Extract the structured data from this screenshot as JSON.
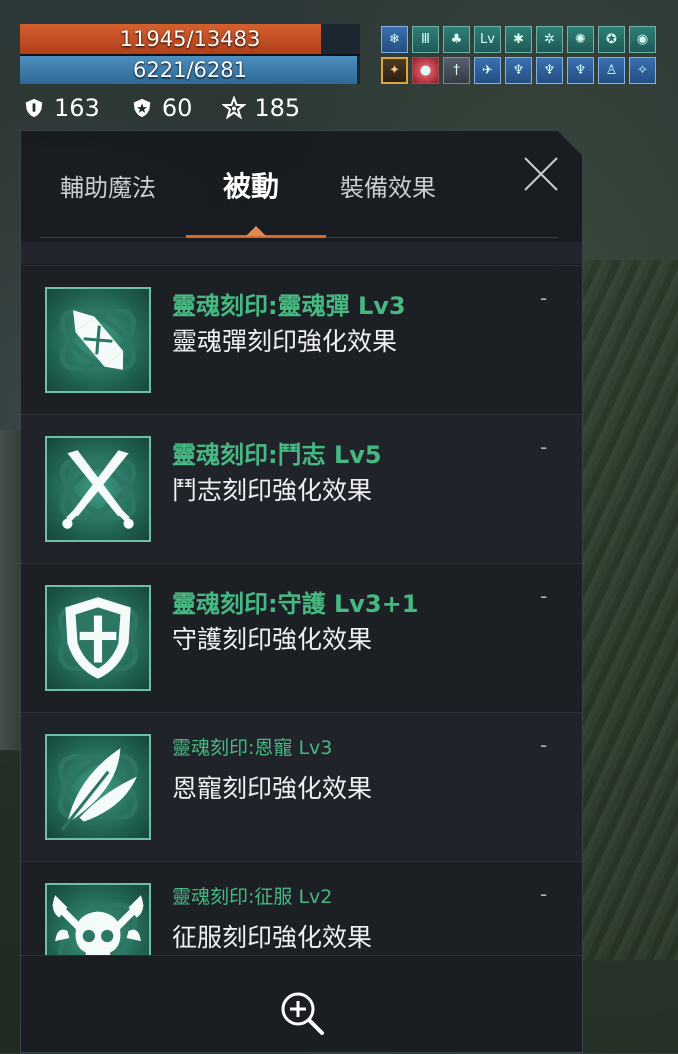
{
  "status": {
    "hp": {
      "text": "11945/13483",
      "current": 11945,
      "max": 13483
    },
    "mp": {
      "text": "6221/6281",
      "current": 6221,
      "max": 6281
    },
    "stats": [
      {
        "icon": "shield-defense-icon",
        "value": "163"
      },
      {
        "icon": "badge-resist-icon",
        "value": "60"
      },
      {
        "icon": "star-rank-icon",
        "value": "185"
      }
    ]
  },
  "buffs": {
    "row1": [
      "ice-crystal-icon",
      "iii-rune-icon",
      "leaf-icon",
      "lv-icon",
      "bug-icon",
      "wings-icon",
      "gear-icon",
      "spiral-icon",
      "drop-icon",
      "wing-icon"
    ],
    "row2": [
      "treasure-icon",
      "red-orb-icon",
      "sword-icon",
      "bird-icon",
      "meditate-icon",
      "meditate-icon",
      "meditate-icon",
      "figure-icon",
      "stars-icon",
      "hand-icon"
    ]
  },
  "tabs": [
    {
      "label": "輔助魔法",
      "active": false
    },
    {
      "label": "被動",
      "active": true
    },
    {
      "label": "裝備效果",
      "active": false
    }
  ],
  "items": [
    {
      "title": "靈魂刻印:靈魂彈 Lv3",
      "desc": "靈魂彈刻印強化效果",
      "icon": "soul-bullet-icon",
      "dash": "-"
    },
    {
      "title": "靈魂刻印:鬥志 Lv5",
      "desc": "鬥志刻印強化效果",
      "icon": "crossed-swords-icon",
      "dash": "-"
    },
    {
      "title": "靈魂刻印:守護 Lv3+1",
      "desc": "守護刻印強化效果",
      "icon": "shield-icon",
      "dash": "-"
    },
    {
      "title": "靈魂刻印:恩寵 Lv3",
      "desc": "恩寵刻印強化效果",
      "icon": "feather-icon",
      "dash": "-"
    },
    {
      "title": "靈魂刻印:征服 Lv2",
      "desc": "征服刻印強化效果",
      "icon": "skull-axes-icon",
      "dash": "-"
    }
  ],
  "colors": {
    "accent": "#d8672a",
    "title_green": "#46b982",
    "hp": "#c4502a",
    "mp": "#3a7cab"
  }
}
